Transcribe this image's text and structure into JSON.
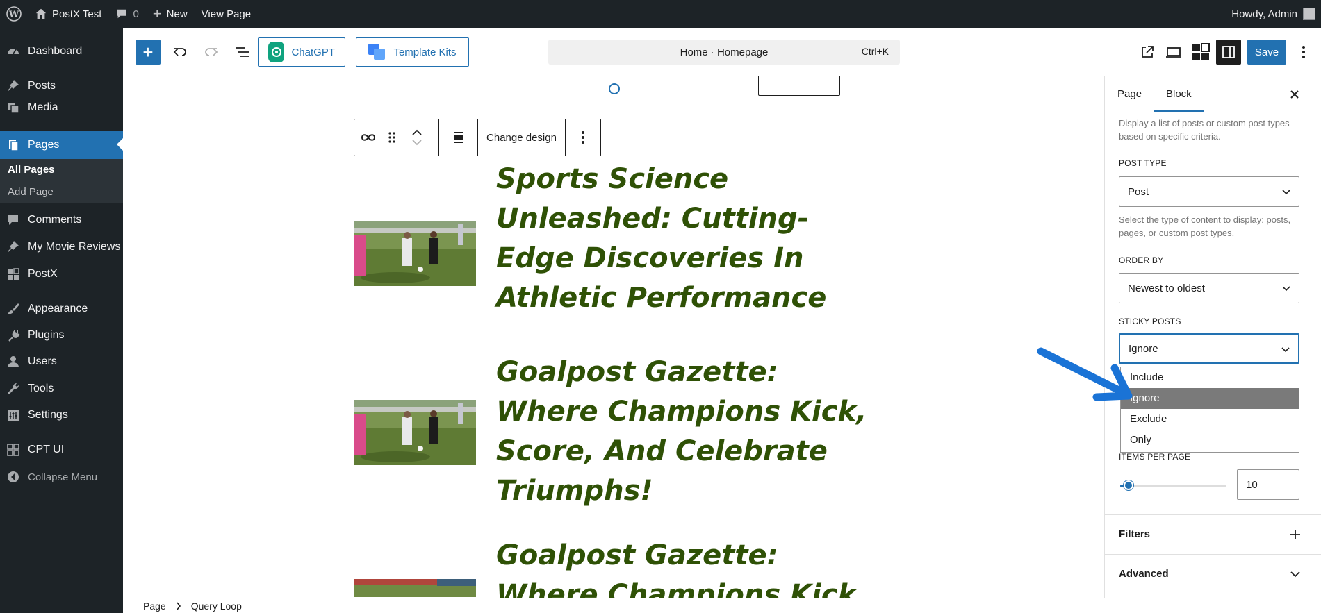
{
  "admin_bar": {
    "site_name": "PostX Test",
    "comments_count": "0",
    "new_label": "New",
    "view_page_label": "View Page",
    "howdy": "Howdy, Admin"
  },
  "sidebar": {
    "items": [
      {
        "label": "Dashboard",
        "icon": "dashboard-icon"
      },
      {
        "label": "Posts",
        "icon": "pin-icon"
      },
      {
        "label": "Media",
        "icon": "media-icon"
      },
      {
        "label": "Pages",
        "icon": "pages-icon"
      },
      {
        "label": "Comments",
        "icon": "comment-icon"
      },
      {
        "label": "My Movie Reviews",
        "icon": "pin-icon"
      },
      {
        "label": "PostX",
        "icon": "postx-icon"
      },
      {
        "label": "Appearance",
        "icon": "brush-icon"
      },
      {
        "label": "Plugins",
        "icon": "plugin-icon"
      },
      {
        "label": "Users",
        "icon": "user-icon"
      },
      {
        "label": "Tools",
        "icon": "wrench-icon"
      },
      {
        "label": "Settings",
        "icon": "settings-icon"
      },
      {
        "label": "CPT UI",
        "icon": "grid-icon"
      },
      {
        "label": "Collapse Menu",
        "icon": "collapse-icon"
      }
    ],
    "submenu": [
      "All Pages",
      "Add Page"
    ]
  },
  "toolbar": {
    "chatgpt_label": "ChatGPT",
    "template_kits_label": "Template Kits",
    "command_title": "Home · Homepage",
    "shortcut": "Ctrl+K",
    "save_label": "Save"
  },
  "block_toolbar": {
    "change_design_label": "Change design"
  },
  "posts": [
    {
      "title": "Sports Science Unleashed: Cutting-Edge Discoveries In Athletic Performance"
    },
    {
      "title": "Goalpost Gazette: Where Champions Kick, Score, And Celebrate Triumphs!"
    },
    {
      "title": "Goalpost Gazette: Where Champions Kick"
    }
  ],
  "footer": {
    "crumbs": [
      "Page",
      "Query Loop"
    ]
  },
  "settings": {
    "tabs": [
      "Page",
      "Block"
    ],
    "active_tab": "Block",
    "description": "Display a list of posts or custom post types based on specific criteria.",
    "post_type": {
      "label": "POST TYPE",
      "value": "Post",
      "help": "Select the type of content to display: posts, pages, or custom post types."
    },
    "order_by": {
      "label": "ORDER BY",
      "value": "Newest to oldest"
    },
    "sticky_posts": {
      "label": "STICKY POSTS",
      "value": "Ignore",
      "options": [
        "Include",
        "Ignore",
        "Exclude",
        "Only"
      ],
      "selected": "Ignore"
    },
    "items_per_page": {
      "label": "ITEMS PER PAGE",
      "value": "10",
      "slider_fraction": 0.08
    },
    "panels": [
      "Filters",
      "Advanced"
    ]
  },
  "colors": {
    "admin_bg": "#1d2327",
    "accent": "#2271b1",
    "title_green": "#2f5106",
    "arrow_blue": "#1a73d6"
  }
}
